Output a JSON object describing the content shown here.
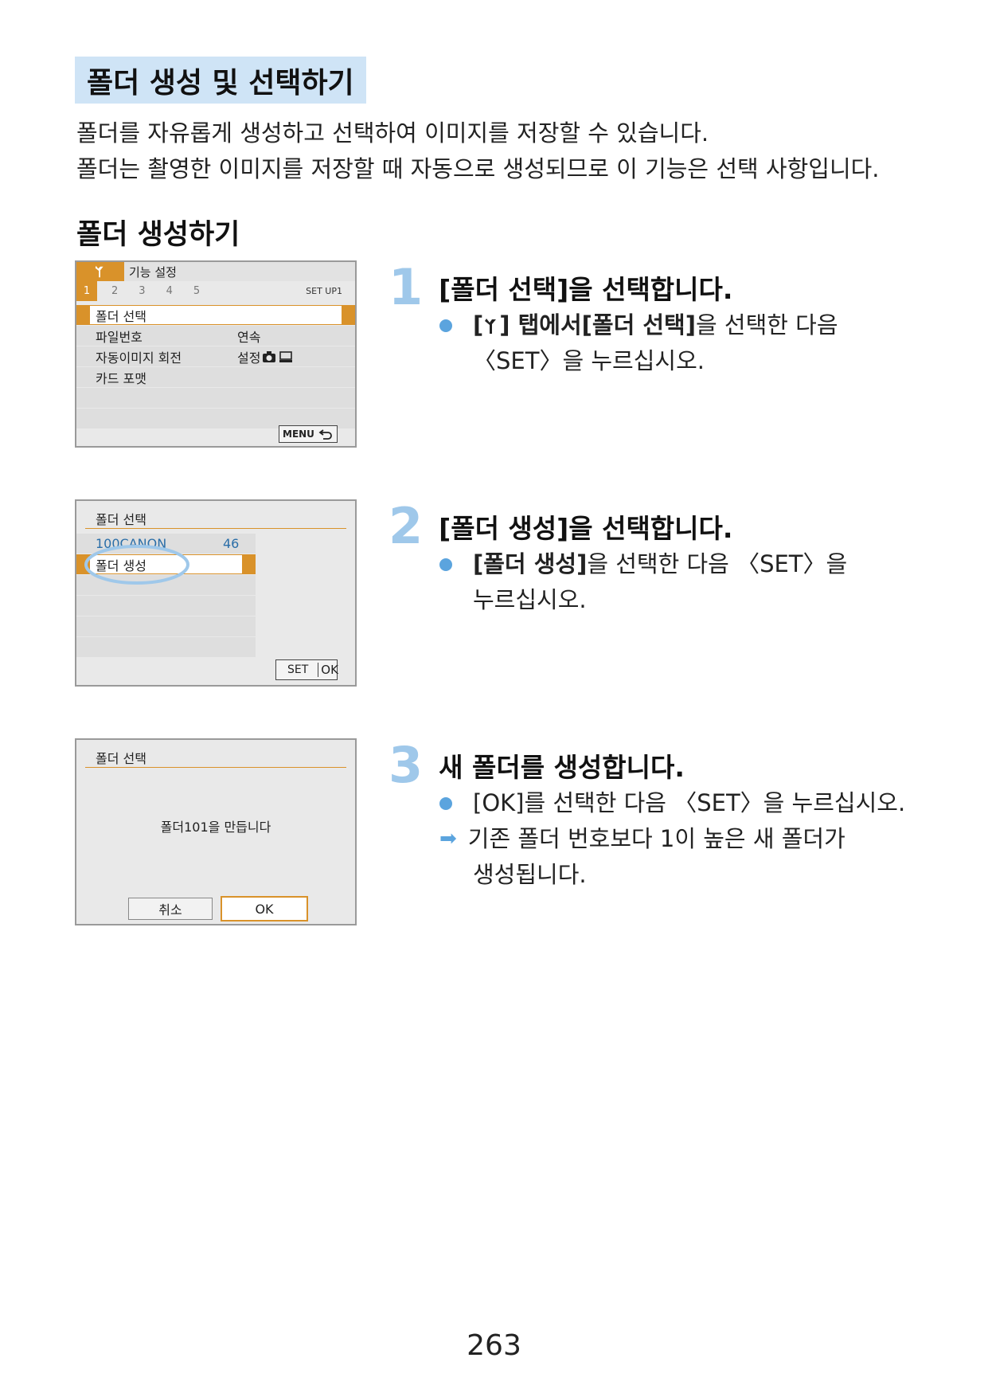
{
  "title": "폴더 생성 및 선택하기",
  "intro": [
    "폴더를 자유롭게 생성하고 선택하여 이미지를 저장할 수 있습니다.",
    "폴더는 촬영한 이미지를 저장할 때 자동으로 생성되므로 이 기능은 선택 사항입니다."
  ],
  "section_heading": "폴더 생성하기",
  "screen1": {
    "tab_title": "기능 설정",
    "tab_numbers": [
      "1",
      "2",
      "3",
      "4",
      "5"
    ],
    "tab_label": "SET UP1",
    "items": [
      {
        "label": "폴더 선택",
        "value": ""
      },
      {
        "label": "파일번호",
        "value": "연속"
      },
      {
        "label": "자동이미지 회전",
        "value": "설정"
      },
      {
        "label": "카드 포맷",
        "value": ""
      }
    ],
    "menu_button": "MENU"
  },
  "screen2": {
    "title": "폴더 선택",
    "folder_name": "100CANON",
    "folder_count": "46",
    "create_item": "폴더 생성",
    "set_label": "SET",
    "ok_label": "OK"
  },
  "screen3": {
    "title": "폴더 선택",
    "message": "폴더101을 만듭니다",
    "cancel": "취소",
    "ok": "OK"
  },
  "steps": [
    {
      "number": "1",
      "title": "[폴더 선택]을 선택합니다.",
      "bullet_open": "[",
      "bullet_close": "] 탭에서 ",
      "bullet_bold": "[폴더 선택]",
      "bullet_rest": "을 선택한 다음",
      "bullet_line2": "〈SET〉을 누르십시오."
    },
    {
      "number": "2",
      "title": "[폴더 생성]을 선택합니다.",
      "bullet_bold": "[폴더 생성]",
      "bullet_rest": "을 선택한 다음 〈SET〉을",
      "bullet_line2": "누르십시오."
    },
    {
      "number": "3",
      "title": "새 폴더를 생성합니다.",
      "bullet": "[OK]를 선택한 다음 〈SET〉을 누르십시오.",
      "result_line1": "기존 폴더 번호보다 1이 높은 새 폴더가",
      "result_line2": "생성됩니다."
    }
  ],
  "page_number": "263",
  "colors": {
    "title_bg": "#cfe4f6",
    "accent_orange": "#d9922a",
    "accent_blue": "#5ba4de",
    "step_number": "#9fc8ea"
  }
}
